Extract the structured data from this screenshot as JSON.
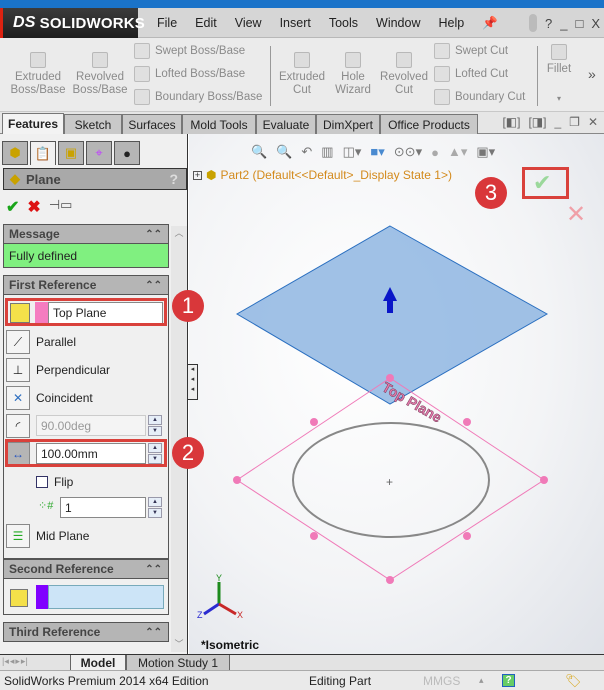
{
  "app": {
    "name": "SOLIDWORKS",
    "logo_prefix": "DS"
  },
  "menu": [
    "File",
    "Edit",
    "View",
    "Insert",
    "Tools",
    "Window",
    "Help"
  ],
  "window_controls": {
    "help": "?",
    "minimize": "_",
    "restore": "□",
    "close": "X"
  },
  "ribbon": {
    "extruded_boss": "Extruded Boss/Base",
    "revolved_boss": "Revolved Boss/Base",
    "swept_boss": "Swept Boss/Base",
    "lofted_boss": "Lofted Boss/Base",
    "boundary_boss": "Boundary Boss/Base",
    "extruded_cut": "Extruded Cut",
    "hole_wizard": "Hole Wizard",
    "revolved_cut": "Revolved Cut",
    "swept_cut": "Swept Cut",
    "lofted_cut": "Lofted Cut",
    "boundary_cut": "Boundary Cut",
    "fillet": "Fillet",
    "more": "»"
  },
  "tabs": [
    "Features",
    "Sketch",
    "Surfaces",
    "Mold Tools",
    "Evaluate",
    "DimXpert",
    "Office Products"
  ],
  "active_tab": "Features",
  "property_manager": {
    "title": "Plane",
    "help": "?",
    "message_header": "Message",
    "message": "Fully defined",
    "message_color": "#80f080",
    "first_reference": {
      "header": "First Reference",
      "selection": "Top Plane",
      "options": [
        "Parallel",
        "Perpendicular",
        "Coincident"
      ],
      "angle_value": "90.00deg",
      "offset_value": "100.00mm",
      "flip_label": "Flip",
      "flip_checked": false,
      "count_value": "1",
      "mid_plane_label": "Mid Plane"
    },
    "second_reference": {
      "header": "Second Reference",
      "selection": ""
    },
    "third_reference": {
      "header": "Third Reference"
    }
  },
  "viewport": {
    "tree_item": "Part2  (Default<<Default>_Display State 1>)",
    "plane_label": "Top Plane",
    "view_name": "*Isometric",
    "axes": {
      "x": "X",
      "y": "Y",
      "z": "Z"
    }
  },
  "annotations": {
    "badge1": "1",
    "badge2": "2",
    "badge3": "3",
    "accent": "#d9373a"
  },
  "bottom_tabs": [
    "Model",
    "Motion Study 1"
  ],
  "status": {
    "edition": "SolidWorks Premium 2014 x64 Edition",
    "mode": "Editing Part",
    "units": "MMGS"
  }
}
